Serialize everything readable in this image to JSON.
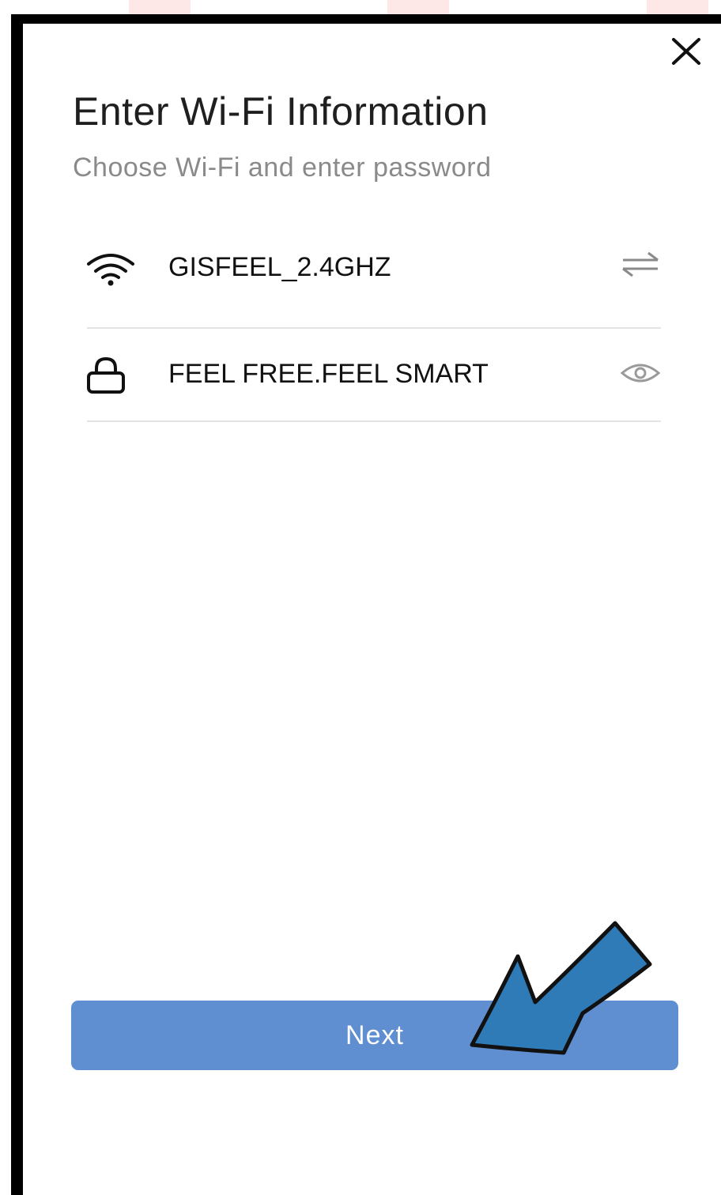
{
  "dialog": {
    "title": "Enter Wi-Fi Information",
    "subtitle": "Choose Wi-Fi and enter password"
  },
  "wifi_field": {
    "icon": "wifi-icon",
    "value": "GISFEEL_2.4GHZ",
    "action_icon": "switch-network-icon"
  },
  "password_field": {
    "icon": "lock-icon",
    "value": "FEEL FREE.FEEL SMART",
    "action_icon": "eye-icon"
  },
  "next_button": {
    "label": "Next"
  },
  "colors": {
    "button_background": "#5f8fd0",
    "annotation_arrow": "#2f7bb8",
    "tab_background": "#fde7e7"
  }
}
